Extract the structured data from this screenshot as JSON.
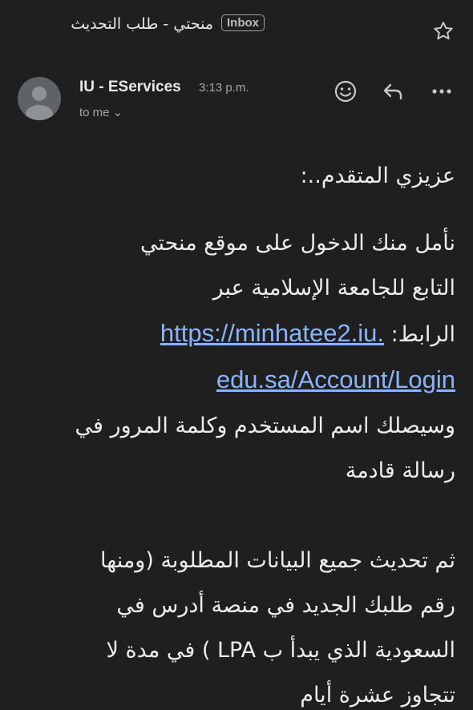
{
  "subject": {
    "title": "منحتي - طلب التحديث",
    "badge": "Inbox"
  },
  "sender": {
    "name": "IU - EServices",
    "time": "3:13 p.m.",
    "to": "to me ⌄"
  },
  "body": {
    "greeting": "عزيزي المتقدم..:",
    "p1_line1": "نأمل منك الدخول على موقع منحتي",
    "p1_line2": "التابع للجامعة الإسلامية عبر",
    "p1_label": "الرابط:",
    "link_part1": "https://minhatee2.iu.",
    "link_part2": "edu.sa/Account/Login",
    "p2_line1": "وسيصلك اسم المستخدم وكلمة المرور في",
    "p2_line2": "رسالة قادمة",
    "p3_line1": "ثم تحديث جميع البيانات المطلوبة (ومنها",
    "p3_line2": "رقم طلبك الجديد في منصة أدرس في",
    "p3_line3": "السعودية الذي يبدأ ب LPA ) في مدة لا",
    "p3_line4": "تتجاوز عشرة أيام"
  },
  "colors": {
    "background": "#1f1f1f",
    "link": "#8ab4f8",
    "muted": "#a6a6a6"
  },
  "icons": [
    "star-icon",
    "avatar-person-icon",
    "emoji-icon",
    "reply-icon",
    "more-icon"
  ]
}
